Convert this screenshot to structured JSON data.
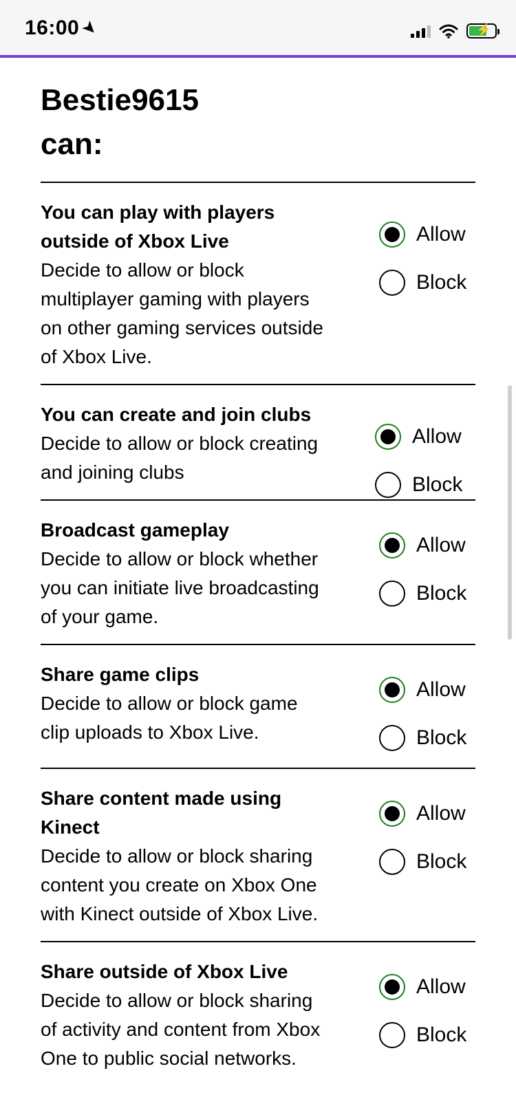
{
  "status": {
    "time": "16:00"
  },
  "heading": "Bestie9615 can:",
  "settings": [
    {
      "title": "You can play with players outside of Xbox Live",
      "desc": "Decide to allow or block multiplayer gaming with players on other gaming services outside of Xbox Live.",
      "allow_label": "Allow",
      "block_label": "Block",
      "selected": "Allow"
    },
    {
      "title": "You can create and join clubs",
      "desc": "Decide to allow or block creating and joining clubs",
      "allow_label": "Allow",
      "block_label": "Block",
      "selected": "Allow"
    },
    {
      "title": "Broadcast gameplay",
      "desc": "Decide to allow or block whether you can initiate live broadcasting of your game.",
      "allow_label": "Allow",
      "block_label": "Block",
      "selected": "Allow"
    },
    {
      "title": "Share game clips",
      "desc": "Decide to allow or block game clip uploads to Xbox Live.",
      "allow_label": "Allow",
      "block_label": "Block",
      "selected": "Allow"
    },
    {
      "title": "Share content made using Kinect",
      "desc": "Decide to allow or block sharing content you create on Xbox One with Kinect outside of Xbox Live.",
      "allow_label": "Allow",
      "block_label": "Block",
      "selected": "Allow"
    },
    {
      "title": "Share outside of Xbox Live",
      "desc": "Decide to allow or block sharing of activity and content from Xbox One to public social networks.",
      "allow_label": "Allow",
      "block_label": "Block",
      "selected": "Allow"
    }
  ],
  "colors": {
    "accent": "#7a3fd6",
    "radio_checked_ring": "#1b7f1b"
  },
  "icons": [
    "location-arrow-icon",
    "signal-icon",
    "wifi-icon",
    "battery-charging-icon"
  ]
}
